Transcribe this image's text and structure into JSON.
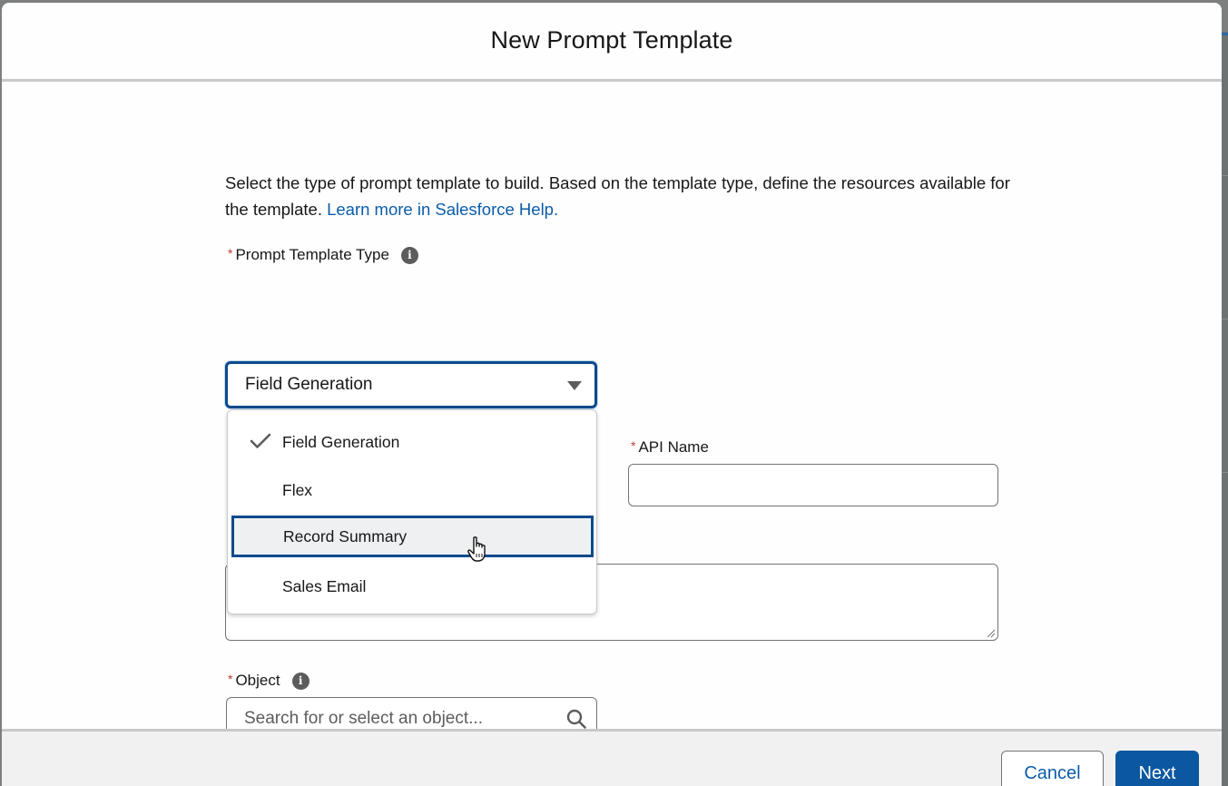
{
  "modal": {
    "title": "New Prompt Template"
  },
  "intro": {
    "text": "Select the type of prompt template to build. Based on the template type, define the resources available for the template.",
    "link_text": "Learn more in Salesforce Help."
  },
  "prompt_template_type": {
    "label": "Prompt Template Type",
    "required_marker": "*",
    "info_glyph": "i",
    "selected_value": "Field Generation",
    "options": [
      {
        "label": "Field Generation",
        "selected": true,
        "hovered": false
      },
      {
        "label": "Flex",
        "selected": false,
        "hovered": false
      },
      {
        "label": "Record Summary",
        "selected": false,
        "hovered": true
      },
      {
        "label": "Sales Email",
        "selected": false,
        "hovered": false
      }
    ]
  },
  "api_name": {
    "label": "API Name",
    "required_marker": "*",
    "value": ""
  },
  "description": {
    "value": ""
  },
  "object": {
    "label": "Object",
    "required_marker": "*",
    "info_glyph": "i",
    "placeholder": "Search for or select an object..."
  },
  "footer": {
    "cancel_label": "Cancel",
    "next_label": "Next"
  },
  "colors": {
    "brand_blue": "#0b57a0",
    "link_blue": "#0b5cab",
    "focus_border": "#0b4a8c",
    "required_red": "#c23934"
  },
  "icons": {
    "info": "info-icon",
    "caret": "chevron-down-icon",
    "check": "check-icon",
    "search": "search-icon",
    "cursor": "hand-pointer-cursor-icon"
  }
}
